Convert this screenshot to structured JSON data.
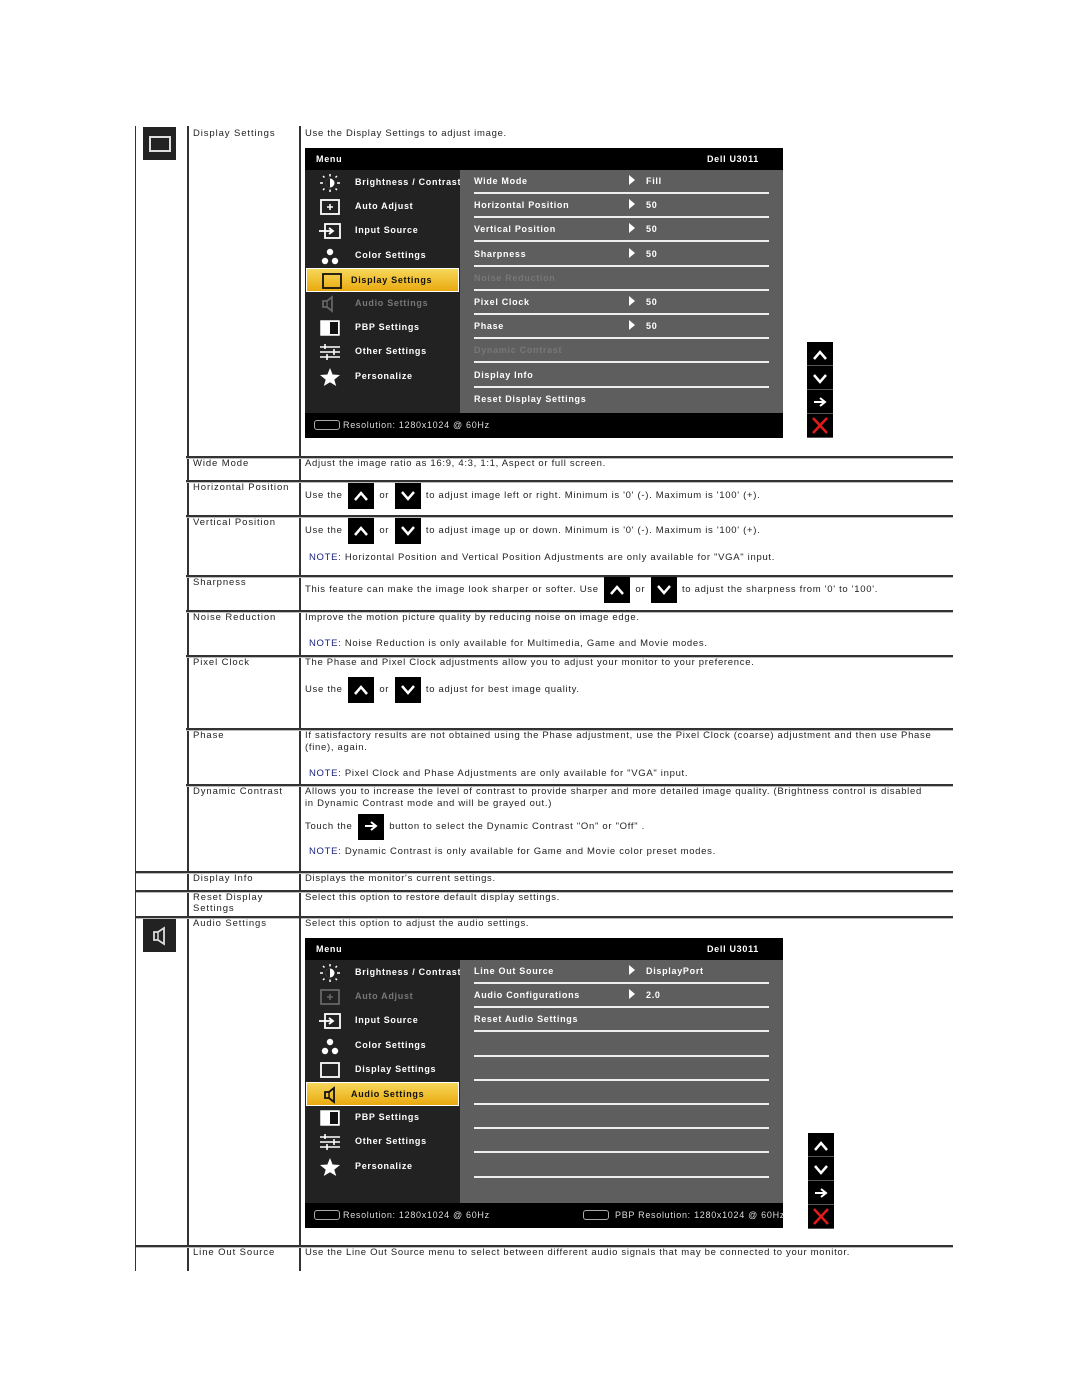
{
  "sections": {
    "display_settings": {
      "icon": "display-settings-icon",
      "name": "Display Settings",
      "intro": "Use the Display Settings to adjust image.",
      "osd": {
        "title": "Menu",
        "model": "Dell U3011",
        "menu": [
          {
            "label": "Brightness / Contrast",
            "icon": "brightness-icon",
            "state": "normal"
          },
          {
            "label": "Auto Adjust",
            "icon": "auto-adjust-icon",
            "state": "normal"
          },
          {
            "label": "Input Source",
            "icon": "input-source-icon",
            "state": "normal"
          },
          {
            "label": "Color Settings",
            "icon": "color-settings-icon",
            "state": "normal"
          },
          {
            "label": "Display Settings",
            "icon": "display-settings-icon",
            "state": "active"
          },
          {
            "label": "Audio Settings",
            "icon": "audio-settings-icon",
            "state": "disabled"
          },
          {
            "label": "PBP Settings",
            "icon": "pbp-settings-icon",
            "state": "normal"
          },
          {
            "label": "Other Settings",
            "icon": "other-settings-icon",
            "state": "normal"
          },
          {
            "label": "Personalize",
            "icon": "star-icon",
            "state": "normal"
          }
        ],
        "submenu": [
          {
            "label": "Wide Mode",
            "value": "Fill",
            "state": "normal"
          },
          {
            "label": "Horizontal Position",
            "value": "50",
            "state": "normal"
          },
          {
            "label": "Vertical Position",
            "value": "50",
            "state": "normal"
          },
          {
            "label": "Sharpness",
            "value": "50",
            "state": "normal"
          },
          {
            "label": "Noise Reduction",
            "value": "",
            "state": "disabled"
          },
          {
            "label": "Pixel Clock",
            "value": "50",
            "state": "normal"
          },
          {
            "label": "Phase",
            "value": "50",
            "state": "normal"
          },
          {
            "label": "Dynamic Contrast",
            "value": "",
            "state": "disabled"
          },
          {
            "label": "Display Info",
            "value": "",
            "state": "normal"
          },
          {
            "label": "Reset Display Settings",
            "value": "",
            "state": "normal"
          }
        ],
        "footer_left": "Resolution: 1280x1024 @ 60Hz",
        "footer_right": ""
      }
    },
    "rows": {
      "wide_mode": {
        "name": "Wide Mode",
        "text": "Adjust the image ratio as 16:9, 4:3, 1:1, Aspect or full screen."
      },
      "horizontal_position": {
        "name": "Horizontal Position",
        "pre": "Use the",
        "or": "or",
        "post": "to adjust image left or right. Minimum is '0' (-). Maximum is '100' (+)."
      },
      "vertical_position": {
        "name": "Vertical Position",
        "pre": "Use the",
        "or": "or",
        "post": "to adjust image up or down. Minimum is '0' (-). Maximum is '100' (+).",
        "note_label": "NOTE:",
        "note": " Horizontal Position and Vertical Position Adjustments are only available for \"VGA\" input."
      },
      "sharpness": {
        "name": "Sharpness",
        "pre": "This feature can make the image look sharper or softer. Use",
        "or": "or",
        "post": "to adjust the sharpness from '0' to '100'."
      },
      "noise_reduction": {
        "name": "Noise Reduction",
        "text": "Improve the motion picture quality by reducing noise on image edge.",
        "note_label": "NOTE:",
        "note": " Noise Reduction is only available for Multimedia, Game and Movie modes."
      },
      "pixel_clock": {
        "name": "Pixel Clock",
        "text": "The Phase and Pixel Clock adjustments allow you to adjust your monitor to your preference.",
        "pre": "Use the",
        "or": "or",
        "post": "to adjust for best image quality."
      },
      "phase": {
        "name": "Phase",
        "text1": "If satisfactory results are not obtained using the Phase adjustment, use the Pixel Clock (coarse) adjustment and then use Phase",
        "text2": "(fine), again.",
        "note_label": "NOTE:",
        "note": " Pixel Clock and Phase Adjustments are only available for \"VGA\" input."
      },
      "dynamic_contrast": {
        "name": "Dynamic Contrast",
        "text1": "Allows you to increase the level of contrast to provide sharper and more detailed image quality. (Brightness control is disabled",
        "text2": "in Dynamic Contrast mode and will be grayed out.)",
        "pre": "Touch the",
        "post": "button to select the Dynamic Contrast \"On\" or \"Off\" .",
        "note_label": "NOTE:",
        "note": " Dynamic Contrast is only available for Game and Movie color preset modes."
      },
      "display_info": {
        "name": "Display Info",
        "text": "Displays the monitor's current settings."
      },
      "reset_display": {
        "name1": "Reset Display",
        "name2": "Settings",
        "text": "Select this option to restore default display settings."
      },
      "line_out_source": {
        "name": "Line Out Source",
        "text": "Use the Line Out Source menu to select between different audio signals that may be connected to your monitor."
      }
    },
    "audio_settings": {
      "icon": "audio-settings-icon",
      "name": "Audio Settings",
      "intro": "Select this option to adjust the audio settings.",
      "osd": {
        "title": "Menu",
        "model": "Dell U3011",
        "menu": [
          {
            "label": "Brightness / Contrast",
            "icon": "brightness-icon",
            "state": "normal"
          },
          {
            "label": "Auto Adjust",
            "icon": "auto-adjust-icon",
            "state": "disabled"
          },
          {
            "label": "Input Source",
            "icon": "input-source-icon",
            "state": "normal"
          },
          {
            "label": "Color Settings",
            "icon": "color-settings-icon",
            "state": "normal"
          },
          {
            "label": "Display Settings",
            "icon": "display-settings-icon",
            "state": "normal"
          },
          {
            "label": "Audio Settings",
            "icon": "audio-settings-icon",
            "state": "active"
          },
          {
            "label": "PBP Settings",
            "icon": "pbp-settings-icon",
            "state": "normal"
          },
          {
            "label": "Other Settings",
            "icon": "other-settings-icon",
            "state": "normal"
          },
          {
            "label": "Personalize",
            "icon": "star-icon",
            "state": "normal"
          }
        ],
        "submenu": [
          {
            "label": "Line Out Source",
            "value": "DisplayPort",
            "state": "normal"
          },
          {
            "label": "Audio Configurations",
            "value": "2.0",
            "state": "normal"
          },
          {
            "label": "Reset Audio Settings",
            "value": "",
            "state": "normal"
          },
          {
            "label": "",
            "value": "",
            "state": "normal"
          },
          {
            "label": "",
            "value": "",
            "state": "normal"
          },
          {
            "label": "",
            "value": "",
            "state": "normal"
          },
          {
            "label": "",
            "value": "",
            "state": "normal"
          },
          {
            "label": "",
            "value": "",
            "state": "normal"
          },
          {
            "label": "",
            "value": "",
            "state": "normal"
          }
        ],
        "footer_left": "Resolution: 1280x1024 @ 60Hz",
        "footer_right": "PBP Resolution: 1280x1024 @ 60Hz"
      }
    }
  },
  "front_keys": [
    "up-key",
    "down-key",
    "enter-key",
    "exit-key"
  ],
  "colors": {
    "note": "#1a237e",
    "highlight": "#f0b82a",
    "exit": "#e31b1b"
  }
}
